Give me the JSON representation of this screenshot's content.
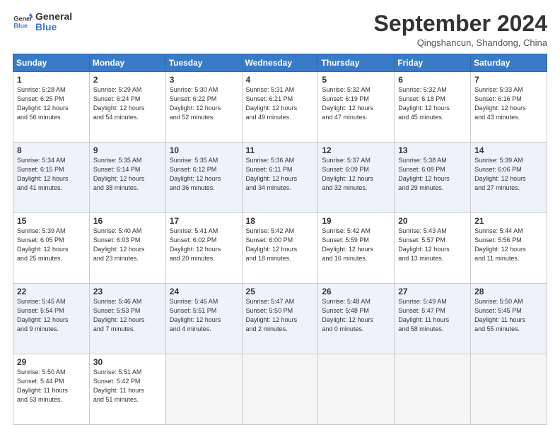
{
  "logo": {
    "line1": "General",
    "line2": "Blue"
  },
  "title": "September 2024",
  "subtitle": "Qingshancun, Shandong, China",
  "weekdays": [
    "Sunday",
    "Monday",
    "Tuesday",
    "Wednesday",
    "Thursday",
    "Friday",
    "Saturday"
  ],
  "weeks": [
    [
      {
        "day": "1",
        "info": "Sunrise: 5:28 AM\nSunset: 6:25 PM\nDaylight: 12 hours\nand 56 minutes."
      },
      {
        "day": "2",
        "info": "Sunrise: 5:29 AM\nSunset: 6:24 PM\nDaylight: 12 hours\nand 54 minutes."
      },
      {
        "day": "3",
        "info": "Sunrise: 5:30 AM\nSunset: 6:22 PM\nDaylight: 12 hours\nand 52 minutes."
      },
      {
        "day": "4",
        "info": "Sunrise: 5:31 AM\nSunset: 6:21 PM\nDaylight: 12 hours\nand 49 minutes."
      },
      {
        "day": "5",
        "info": "Sunrise: 5:32 AM\nSunset: 6:19 PM\nDaylight: 12 hours\nand 47 minutes."
      },
      {
        "day": "6",
        "info": "Sunrise: 5:32 AM\nSunset: 6:18 PM\nDaylight: 12 hours\nand 45 minutes."
      },
      {
        "day": "7",
        "info": "Sunrise: 5:33 AM\nSunset: 6:16 PM\nDaylight: 12 hours\nand 43 minutes."
      }
    ],
    [
      {
        "day": "8",
        "info": "Sunrise: 5:34 AM\nSunset: 6:15 PM\nDaylight: 12 hours\nand 41 minutes."
      },
      {
        "day": "9",
        "info": "Sunrise: 5:35 AM\nSunset: 6:14 PM\nDaylight: 12 hours\nand 38 minutes."
      },
      {
        "day": "10",
        "info": "Sunrise: 5:35 AM\nSunset: 6:12 PM\nDaylight: 12 hours\nand 36 minutes."
      },
      {
        "day": "11",
        "info": "Sunrise: 5:36 AM\nSunset: 6:11 PM\nDaylight: 12 hours\nand 34 minutes."
      },
      {
        "day": "12",
        "info": "Sunrise: 5:37 AM\nSunset: 6:09 PM\nDaylight: 12 hours\nand 32 minutes."
      },
      {
        "day": "13",
        "info": "Sunrise: 5:38 AM\nSunset: 6:08 PM\nDaylight: 12 hours\nand 29 minutes."
      },
      {
        "day": "14",
        "info": "Sunrise: 5:39 AM\nSunset: 6:06 PM\nDaylight: 12 hours\nand 27 minutes."
      }
    ],
    [
      {
        "day": "15",
        "info": "Sunrise: 5:39 AM\nSunset: 6:05 PM\nDaylight: 12 hours\nand 25 minutes."
      },
      {
        "day": "16",
        "info": "Sunrise: 5:40 AM\nSunset: 6:03 PM\nDaylight: 12 hours\nand 23 minutes."
      },
      {
        "day": "17",
        "info": "Sunrise: 5:41 AM\nSunset: 6:02 PM\nDaylight: 12 hours\nand 20 minutes."
      },
      {
        "day": "18",
        "info": "Sunrise: 5:42 AM\nSunset: 6:00 PM\nDaylight: 12 hours\nand 18 minutes."
      },
      {
        "day": "19",
        "info": "Sunrise: 5:42 AM\nSunset: 5:59 PM\nDaylight: 12 hours\nand 16 minutes."
      },
      {
        "day": "20",
        "info": "Sunrise: 5:43 AM\nSunset: 5:57 PM\nDaylight: 12 hours\nand 13 minutes."
      },
      {
        "day": "21",
        "info": "Sunrise: 5:44 AM\nSunset: 5:56 PM\nDaylight: 12 hours\nand 11 minutes."
      }
    ],
    [
      {
        "day": "22",
        "info": "Sunrise: 5:45 AM\nSunset: 5:54 PM\nDaylight: 12 hours\nand 9 minutes."
      },
      {
        "day": "23",
        "info": "Sunrise: 5:46 AM\nSunset: 5:53 PM\nDaylight: 12 hours\nand 7 minutes."
      },
      {
        "day": "24",
        "info": "Sunrise: 5:46 AM\nSunset: 5:51 PM\nDaylight: 12 hours\nand 4 minutes."
      },
      {
        "day": "25",
        "info": "Sunrise: 5:47 AM\nSunset: 5:50 PM\nDaylight: 12 hours\nand 2 minutes."
      },
      {
        "day": "26",
        "info": "Sunrise: 5:48 AM\nSunset: 5:48 PM\nDaylight: 12 hours\nand 0 minutes."
      },
      {
        "day": "27",
        "info": "Sunrise: 5:49 AM\nSunset: 5:47 PM\nDaylight: 11 hours\nand 58 minutes."
      },
      {
        "day": "28",
        "info": "Sunrise: 5:50 AM\nSunset: 5:45 PM\nDaylight: 11 hours\nand 55 minutes."
      }
    ],
    [
      {
        "day": "29",
        "info": "Sunrise: 5:50 AM\nSunset: 5:44 PM\nDaylight: 11 hours\nand 53 minutes."
      },
      {
        "day": "30",
        "info": "Sunrise: 5:51 AM\nSunset: 5:42 PM\nDaylight: 11 hours\nand 51 minutes."
      },
      {
        "day": "",
        "info": ""
      },
      {
        "day": "",
        "info": ""
      },
      {
        "day": "",
        "info": ""
      },
      {
        "day": "",
        "info": ""
      },
      {
        "day": "",
        "info": ""
      }
    ]
  ]
}
